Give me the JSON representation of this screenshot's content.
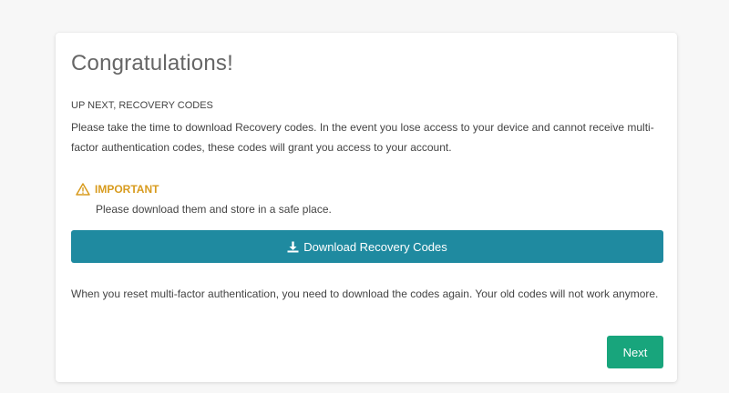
{
  "page": {
    "title": "Congratulations!",
    "subheading": "UP NEXT, RECOVERY CODES",
    "intro": "Please take the time to download Recovery codes. In the event you lose access to your device and cannot receive multi-factor authentication codes, these codes will grant you access to your account.",
    "important": {
      "icon": "warning-icon",
      "label": "IMPORTANT",
      "text": "Please download them and store in a safe place."
    },
    "download_button": {
      "icon": "download-icon",
      "label": "Download Recovery Codes"
    },
    "note": "When you reset multi-factor authentication, you need to download the codes again. Your old codes will not work anymore.",
    "next_button": {
      "label": "Next"
    }
  },
  "colors": {
    "background": "#f7f7f7",
    "card": "#ffffff",
    "title_text": "#666666",
    "body_text": "#444444",
    "warning": "#d89b1e",
    "download_button": "#1f8aa0",
    "next_button": "#18a57c"
  }
}
